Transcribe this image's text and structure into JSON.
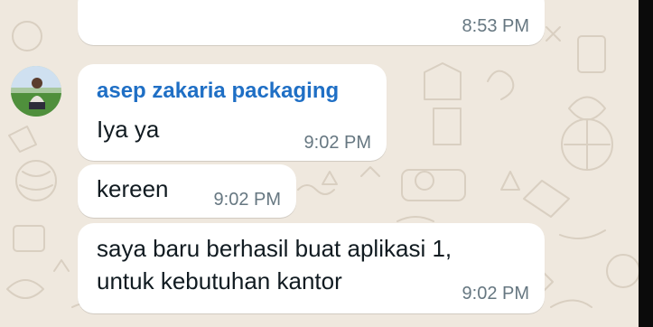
{
  "chat": {
    "messages": [
      {
        "direction": "incoming",
        "sender": "",
        "text": "",
        "time": "8:53 PM"
      },
      {
        "direction": "incoming",
        "sender": "asep zakaria packaging",
        "text": "Iya ya",
        "time": "9:02 PM"
      },
      {
        "direction": "incoming",
        "sender": "",
        "text": "kereen",
        "time": "9:02 PM"
      },
      {
        "direction": "incoming",
        "sender": "",
        "text_lines": [
          "saya baru berhasil buat aplikasi 1,",
          "untuk kebutuhan kantor"
        ],
        "time": "9:02 PM"
      }
    ],
    "avatar_icon": "profile-photo",
    "colors": {
      "wallpaper": "#efe8de",
      "bubble": "#ffffff",
      "sender_name": "#1f6fc5",
      "text": "#111b21",
      "timestamp": "#667781"
    }
  }
}
